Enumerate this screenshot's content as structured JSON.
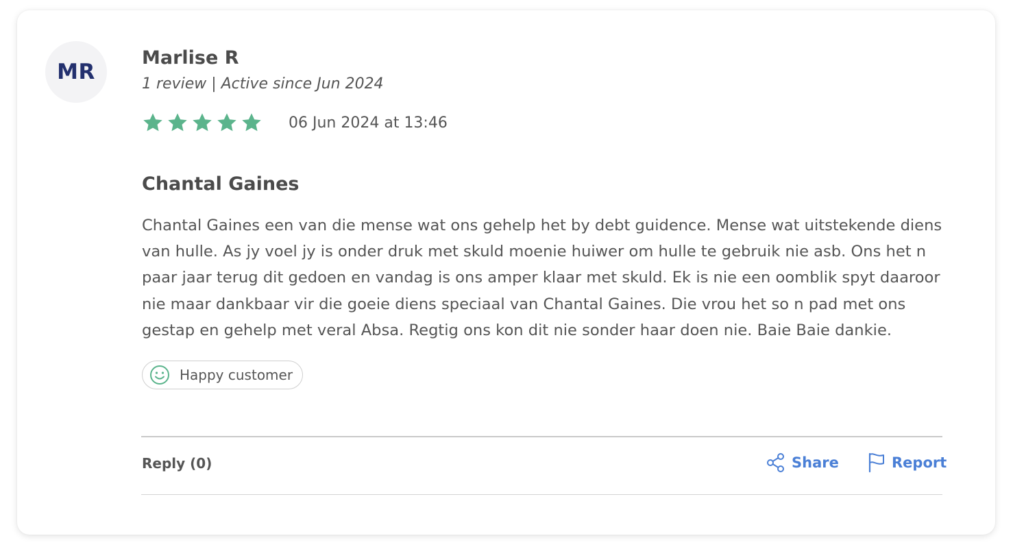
{
  "author": {
    "initials": "MR",
    "name": "Marlise R",
    "meta": "1 review | Active since Jun 2024"
  },
  "review": {
    "rating": 5,
    "rating_max": 5,
    "star_color": "#5bb48c",
    "date": "06 Jun 2024 at 13:46",
    "title": "Chantal Gaines",
    "body": "Chantal Gaines een van die mense wat ons gehelp het by debt guidence. Mense wat uitstekende diens van hulle. As jy voel jy is onder druk met skuld moenie huiwer om hulle te gebruik nie asb. Ons het n paar jaar terug dit gedoen en vandag is ons amper klaar met skuld. Ek is nie een oomblik spyt daaroor nie maar dankbaar vir die goeie diens speciaal van Chantal Gaines. Die vrou het so n pad met ons gestap en gehelp met veral Absa. Regtig ons kon dit nie sonder haar doen nie. Baie Baie dankie.",
    "tag": {
      "label": "Happy customer",
      "icon": "smiley-icon"
    }
  },
  "footer": {
    "reply_label": "Reply (0)",
    "share_label": "Share",
    "share_icon": "share-icon",
    "report_label": "Report",
    "report_icon": "flag-icon",
    "action_color": "#4a7fd6"
  }
}
